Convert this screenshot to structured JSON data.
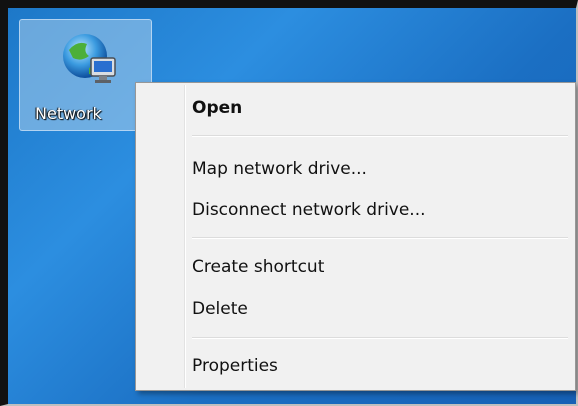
{
  "desktop": {
    "background_color": "#1d78c8",
    "icon": {
      "name": "network-icon",
      "label": "Network"
    }
  },
  "context_menu": {
    "items": [
      {
        "label": "Open",
        "bold": true
      },
      {
        "label": "Map network drive..."
      },
      {
        "label": "Disconnect network drive..."
      },
      {
        "label": "Create shortcut"
      },
      {
        "label": "Delete"
      },
      {
        "label": "Properties"
      }
    ]
  }
}
